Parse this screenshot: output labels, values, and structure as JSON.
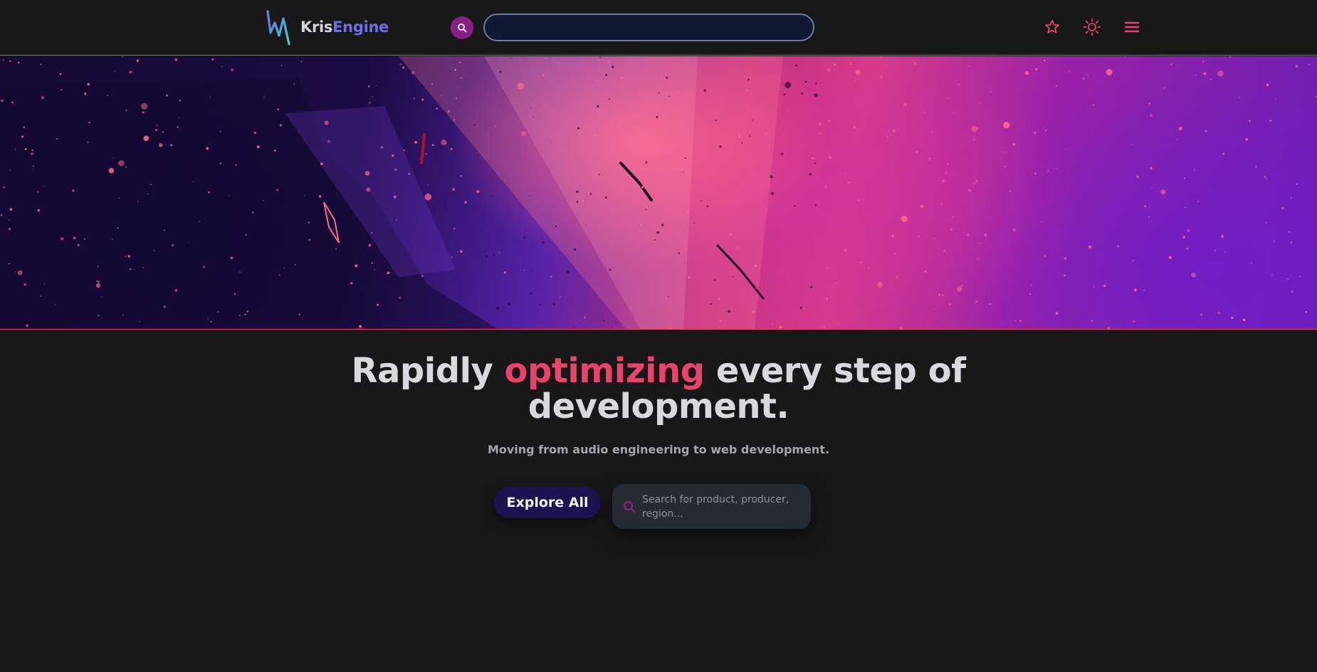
{
  "header": {
    "logo": {
      "text_part1": "Kris",
      "text_part2": "Engine",
      "icon": "logo-mark"
    },
    "search": {
      "button_icon": "search-icon",
      "value": "",
      "placeholder": ""
    },
    "actions": [
      {
        "icon": "star-icon"
      },
      {
        "icon": "sun-icon"
      },
      {
        "icon": "menu-icon"
      }
    ]
  },
  "hero_banner": {
    "description_icon": "abstract-pink-purple-particles"
  },
  "hero": {
    "headline_before": "Rapidly",
    "headline_accent": "optimizing",
    "headline_after": "every step of development.",
    "subheadline": "Moving from audio engineering to web development.",
    "explore_button_label": "Explore All",
    "search": {
      "icon": "search-icon",
      "placeholder": "Search for product, producer, region..."
    }
  },
  "colors": {
    "background": "#181818",
    "accent_pink": "#e8426d",
    "brand_purple": "#6f6ee6",
    "header_search_button": "#8a1f86",
    "explore_button_bg": "#1b1451",
    "hero_search_bg": "#262a33"
  }
}
